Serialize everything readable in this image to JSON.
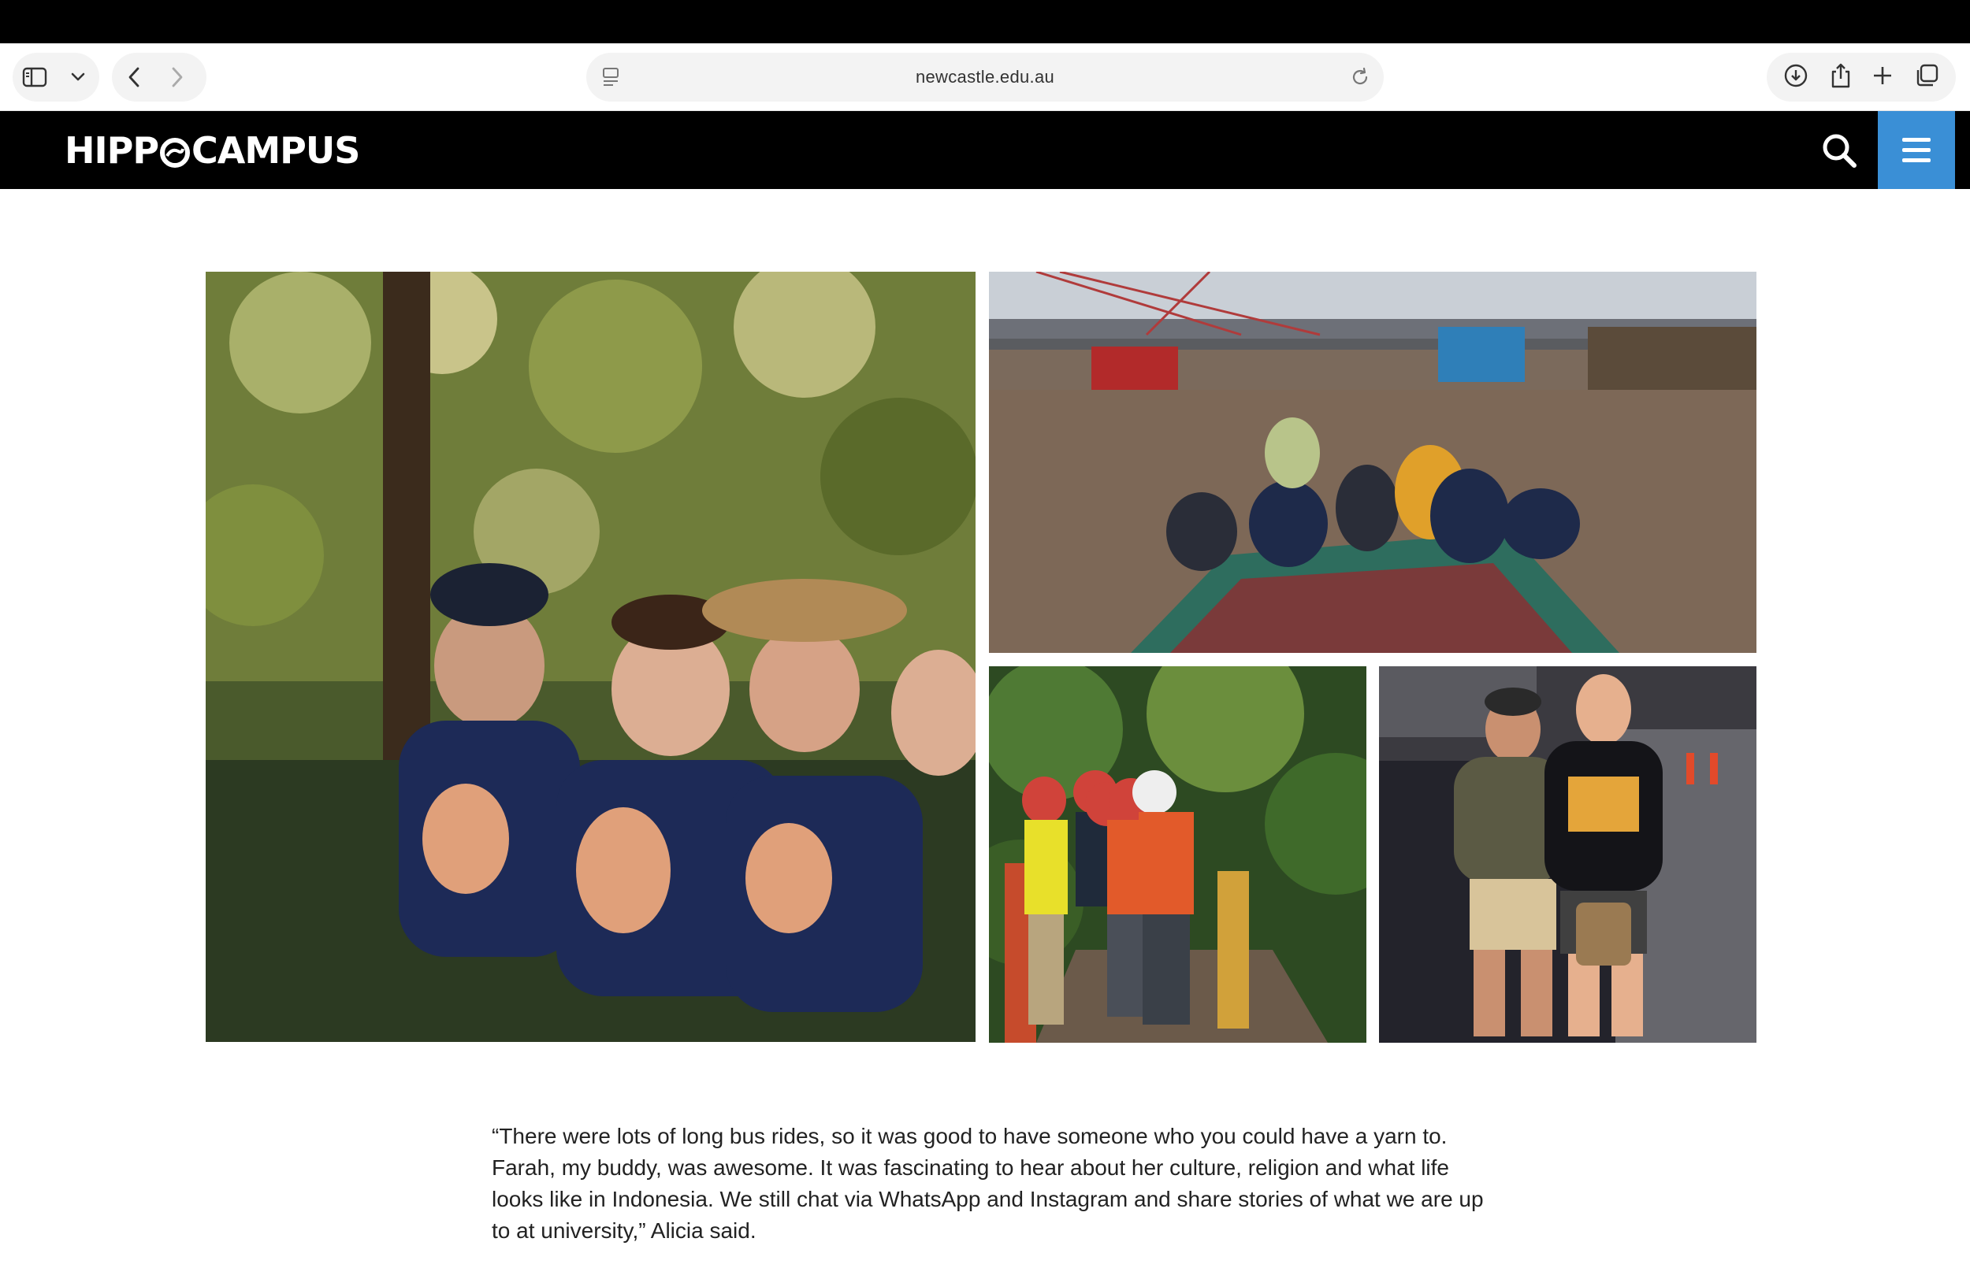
{
  "browser": {
    "url": "newcastle.edu.au"
  },
  "site": {
    "logo_text_left": "HIPP",
    "logo_text_right": "CAMPUS",
    "accent_color": "#3a8fd6"
  },
  "gallery": {
    "images": [
      {
        "name": "students-smiling-forest"
      },
      {
        "name": "students-on-boat-river"
      },
      {
        "name": "students-hardhats-forest-bridge"
      },
      {
        "name": "two-friends-night-street"
      }
    ]
  },
  "article": {
    "quote": "“There were lots of long bus rides, so it was good to have someone who you could have a yarn to. Farah, my buddy, was awesome. It was fascinating to hear about her culture, religion and what life looks like in Indonesia. We still chat via WhatsApp and Instagram and share stories of what we are up to at university,” Alicia said."
  }
}
